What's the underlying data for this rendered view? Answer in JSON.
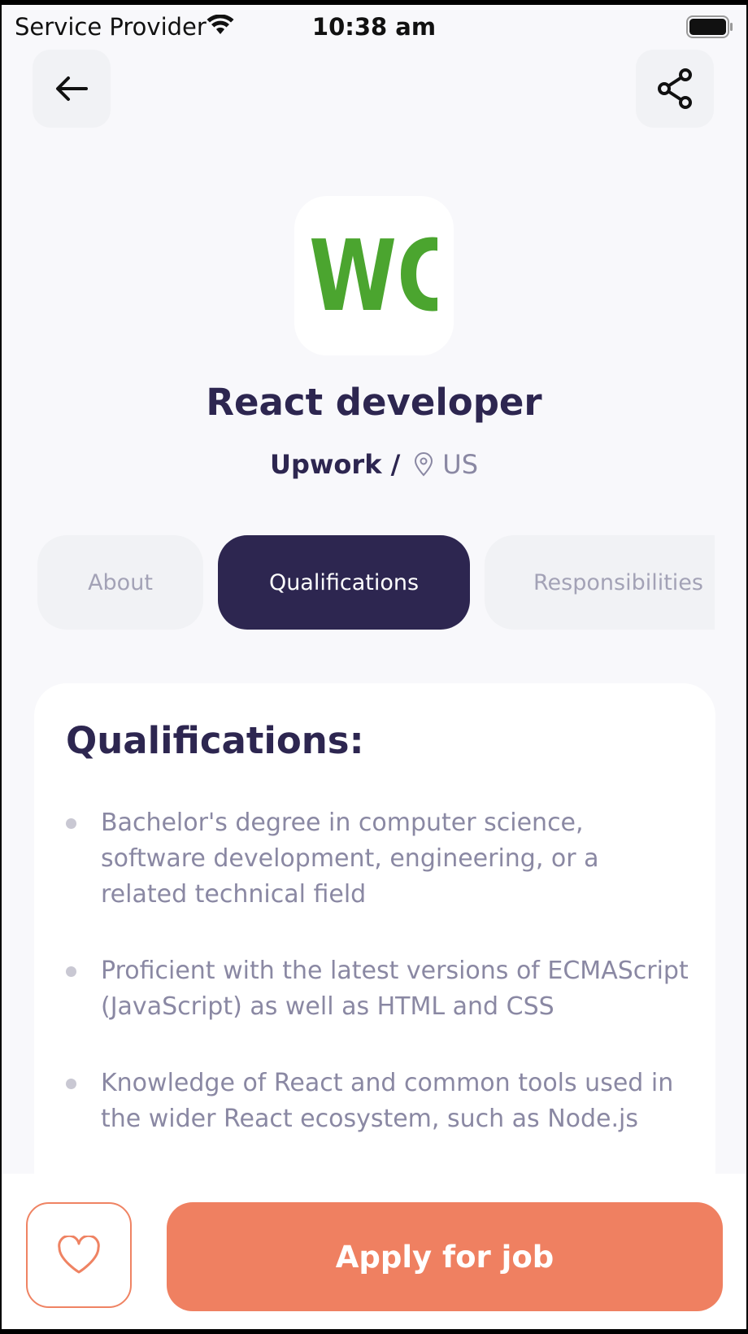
{
  "status_bar": {
    "carrier": "Service Provider",
    "time": "10:38 am"
  },
  "header": {
    "back_icon": "arrow-left-icon",
    "share_icon": "share-icon"
  },
  "job": {
    "logo_text": "WC",
    "logo_color": "#4ba52f",
    "title": "React developer",
    "company": "Upwork /",
    "location_icon": "map-pin-icon",
    "location": "US"
  },
  "tabs": [
    {
      "label": "About",
      "active": false
    },
    {
      "label": "Qualifications",
      "active": true
    },
    {
      "label": "Responsibilities",
      "active": false
    }
  ],
  "content": {
    "heading": "Qualifications:",
    "items": [
      "Bachelor's degree in computer science, software development, engineering, or a related technical field",
      "Proficient with the latest versions of ECMAScript (JavaScript) as well as HTML and CSS",
      "Knowledge of React and common tools used in the wider React ecosystem, such as Node.js"
    ]
  },
  "footer": {
    "favorite_icon": "heart-icon",
    "apply_label": "Apply for job"
  },
  "colors": {
    "primary_dark": "#2d2650",
    "accent": "#ef8061",
    "muted_text": "#8a88a3"
  }
}
